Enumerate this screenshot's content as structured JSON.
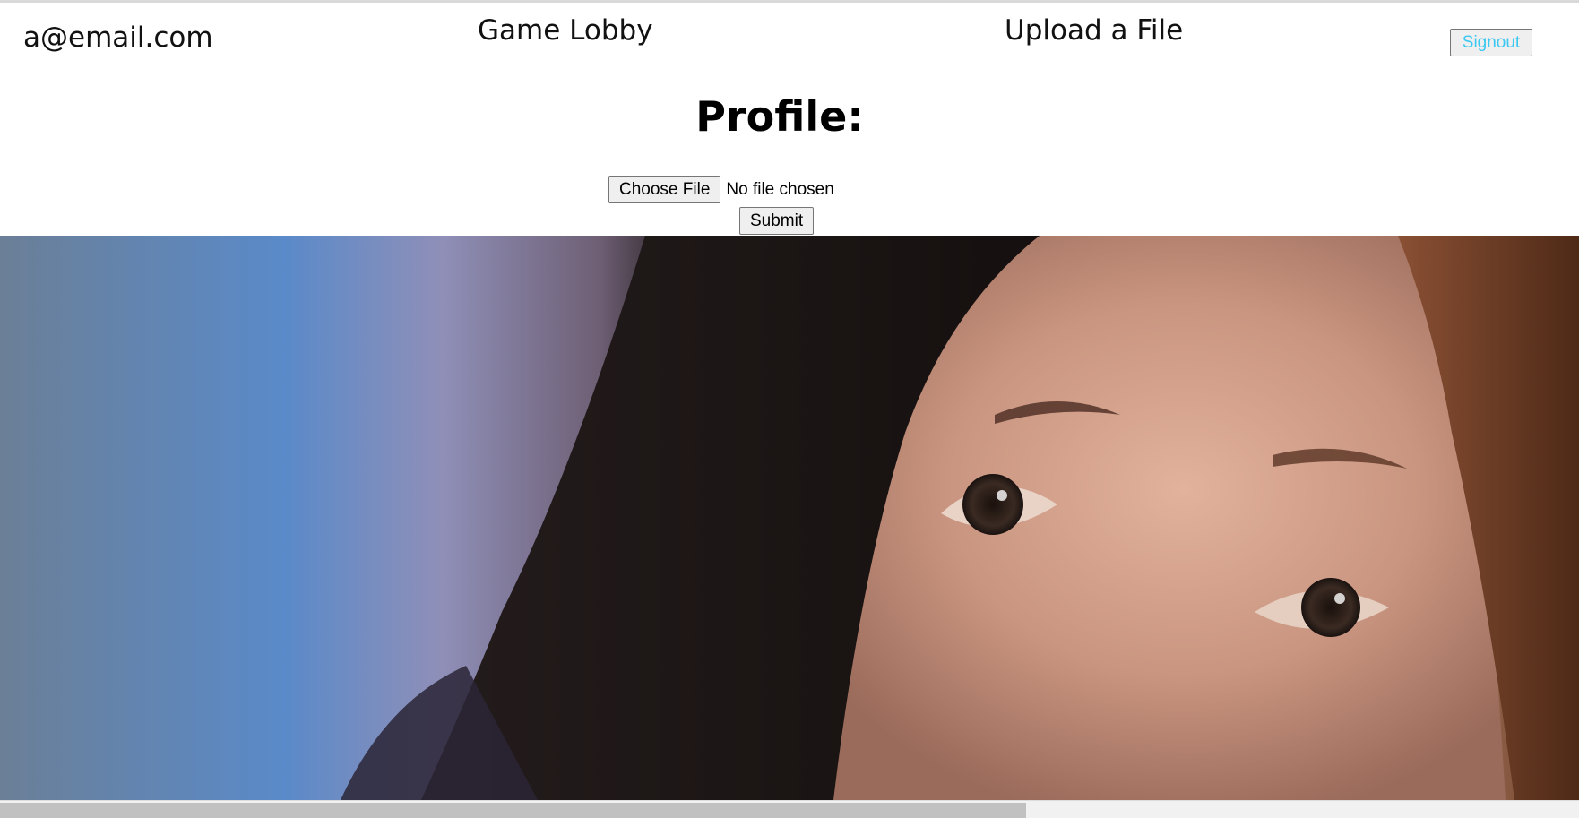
{
  "header": {
    "user_email": "a@email.com",
    "nav_lobby": "Game Lobby",
    "nav_upload": "Upload a File",
    "signout_label": "Signout"
  },
  "profile": {
    "title": "Profile:",
    "choose_file_label": "Choose File",
    "file_status": "No file chosen",
    "submit_label": "Submit"
  },
  "colors": {
    "signout_text": "#3cc8f0",
    "button_bg": "#efefef",
    "button_border": "#767676"
  },
  "icons": {
    "photo": "profile-photo"
  }
}
